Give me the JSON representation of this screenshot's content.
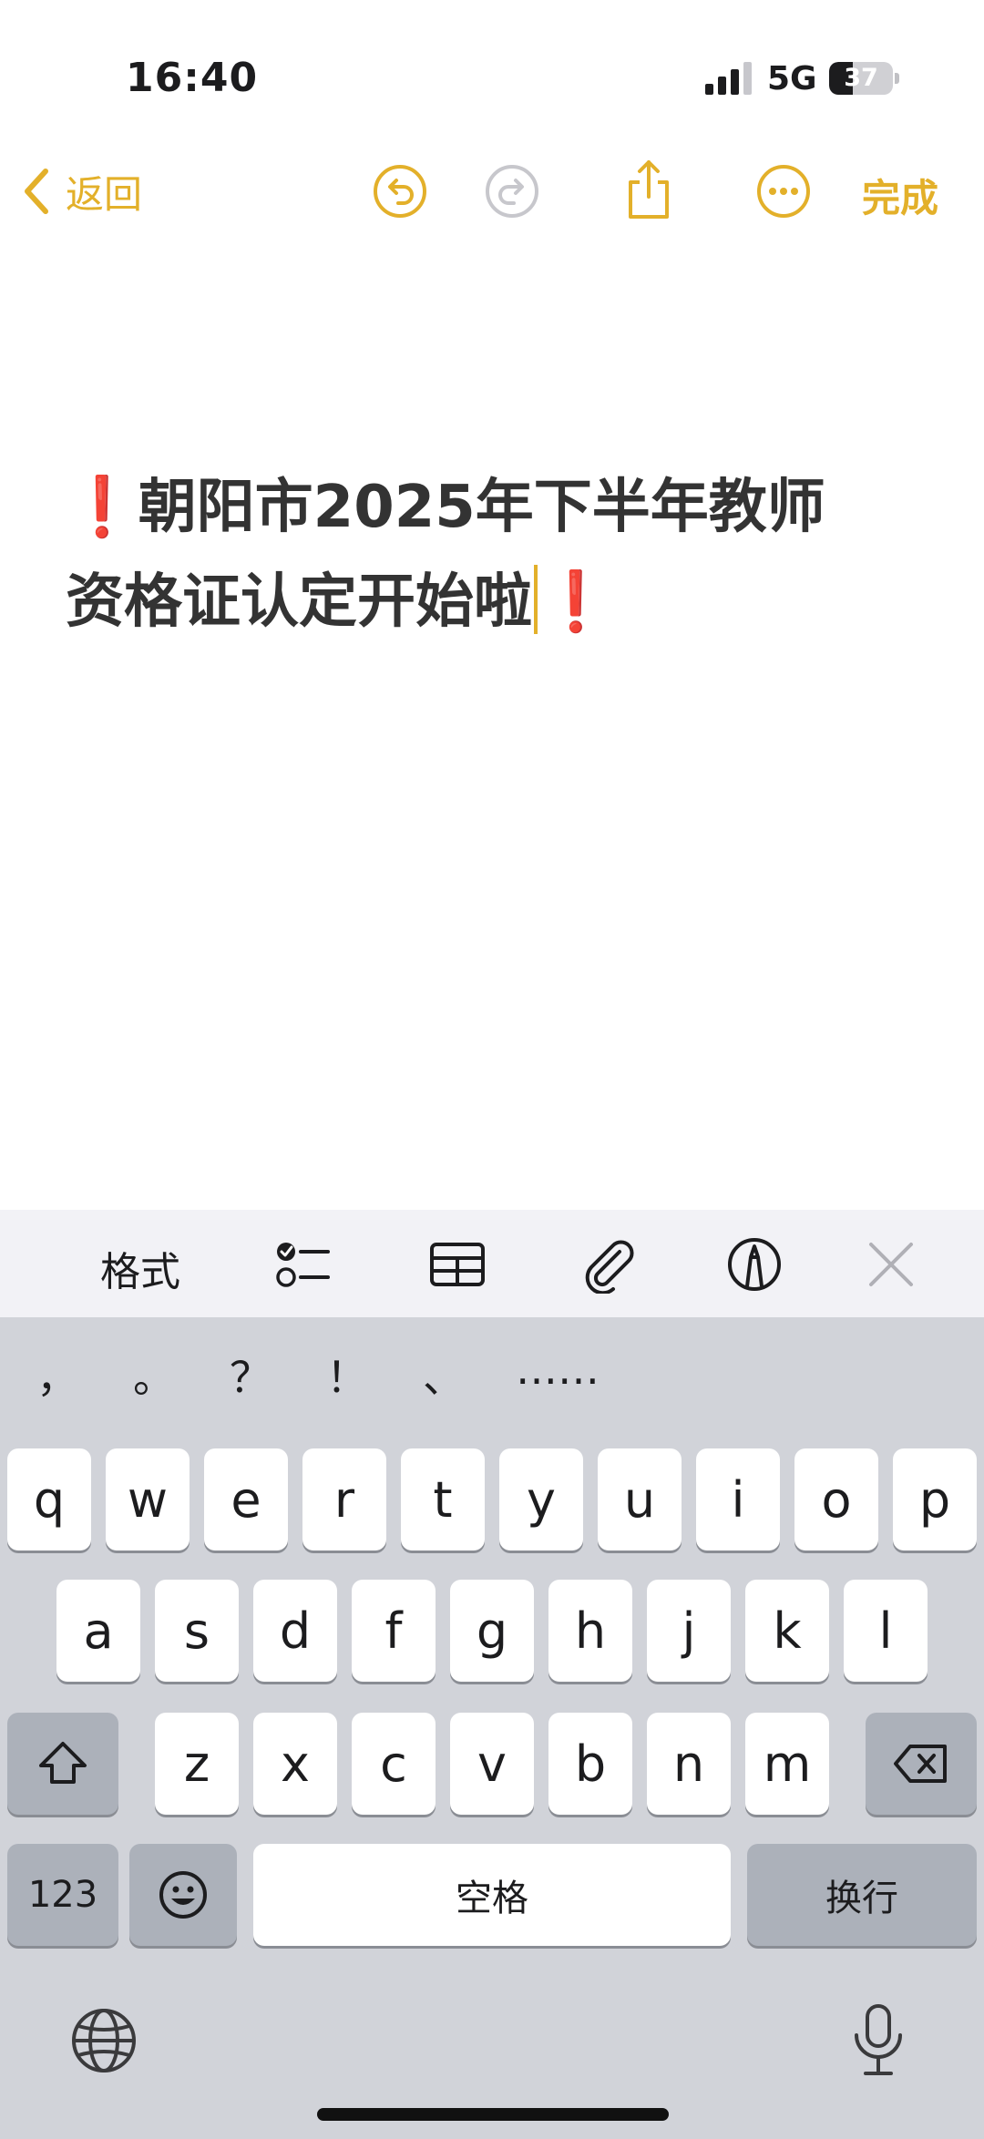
{
  "status_bar": {
    "time": "16:40",
    "network": "5G",
    "battery_percent": 37,
    "battery_label": "37",
    "icons": [
      "signal-icon",
      "battery-icon"
    ]
  },
  "toolbar": {
    "back_label": "返回",
    "done_label": "完成",
    "accent_color": "#e3b02a",
    "icons": [
      "chevron-left-icon",
      "undo-icon",
      "redo-icon",
      "share-icon",
      "more-icon"
    ]
  },
  "note": {
    "mark": "❗",
    "line1": "朝阳市2025年下半年教师",
    "line2": "资格证认定开始啦",
    "mark_color": "#e01b24"
  },
  "format_bar": {
    "format_label": "格式",
    "icons": [
      "checklist-icon",
      "table-icon",
      "paperclip-icon",
      "markup-pen-icon",
      "close-icon"
    ]
  },
  "keyboard": {
    "punctuation": [
      "，",
      "。",
      "？",
      "！",
      "、",
      "……"
    ],
    "row1": [
      "q",
      "w",
      "e",
      "r",
      "t",
      "y",
      "u",
      "i",
      "o",
      "p"
    ],
    "row2": [
      "a",
      "s",
      "d",
      "f",
      "g",
      "h",
      "j",
      "k",
      "l"
    ],
    "row3": [
      "z",
      "x",
      "c",
      "v",
      "b",
      "n",
      "m"
    ],
    "numbers_label": "123",
    "space_label": "空格",
    "return_label": "换行",
    "icons": [
      "shift-icon",
      "backspace-icon",
      "emoji-icon",
      "globe-icon",
      "microphone-icon"
    ]
  }
}
